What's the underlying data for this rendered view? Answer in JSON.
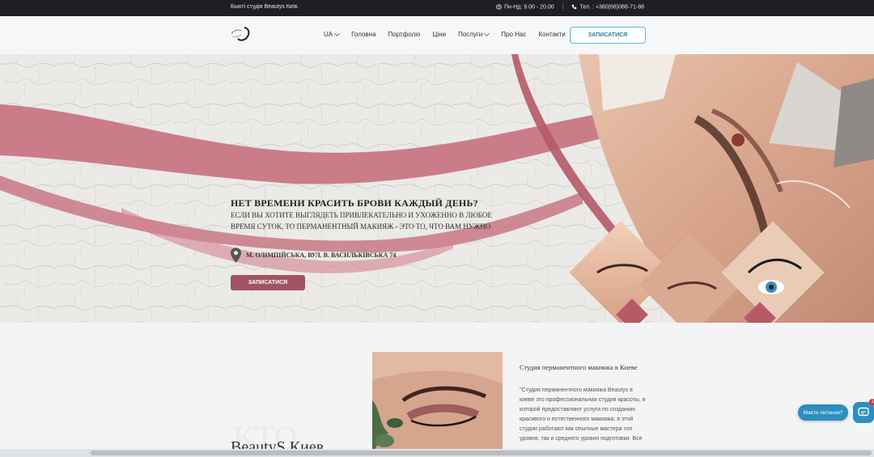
{
  "topbar": {
    "left_text": "Бьюті студія Beautys Київ.",
    "hours": "Пн-Нд: 9.00 - 20.00",
    "separator": "|",
    "phone": "Тел. : +380(68)088-71-88"
  },
  "nav": {
    "items": [
      {
        "label": "UA",
        "dropdown": true
      },
      {
        "label": "Головна",
        "dropdown": false
      },
      {
        "label": "Портфоліо",
        "dropdown": false
      },
      {
        "label": "Ціни",
        "dropdown": false
      },
      {
        "label": "Послуги",
        "dropdown": true
      },
      {
        "label": "Про Нас",
        "dropdown": false
      },
      {
        "label": "Контакти",
        "dropdown": false
      }
    ],
    "cta": "ЗАПИСАТИСЯ"
  },
  "hero": {
    "title": "НЕТ ВРЕМЕНИ КРАСИТЬ БРОВИ КАЖДЫЙ ДЕНЬ?",
    "subtitle": "ЕСЛИ ВЫ ХОТИТЕ ВЫГЛЯДЕТЬ ПРИВЛЕКАТЕЛЬНО И УХОЖЕННО В ЛЮБОЕ ВРЕМЯ СУТОК, ТО ПЕРМАНЕНТНЫЙ МАКИЯЖ - ЭТО ТО, ЧТО ВАМ НУЖНО",
    "address": "М. ОЛІМПІЙСЬКА, ВУЛ. В. ВАСИЛЬКІВСЬКА 74",
    "button": "ЗАПИСАТИСЯ"
  },
  "about": {
    "watermark": "КТО",
    "brand": "BeautyS Киев",
    "title": "Студия перманентного макияжа в Киеве",
    "text": "\"Студия перманентного макияжа Beautys в киеве это профессиональная студия красоты, в которой предоставляют услуги по созданию красивого и естественного макияжа, в этой студии работают как опытные мастера топ уровня, так и среднего уровня подготовки. Все"
  },
  "chat": {
    "label": "Маєте питання?",
    "badge": "1"
  },
  "colors": {
    "accent_pink": "#c8707d",
    "button_maroon": "#a25362",
    "nav_button_border": "#5ab6de",
    "chat_blue": "#2c8fc0"
  },
  "icons": [
    "clock-icon",
    "phone-icon",
    "map-pin-icon",
    "chat-icon",
    "logo-icon"
  ]
}
